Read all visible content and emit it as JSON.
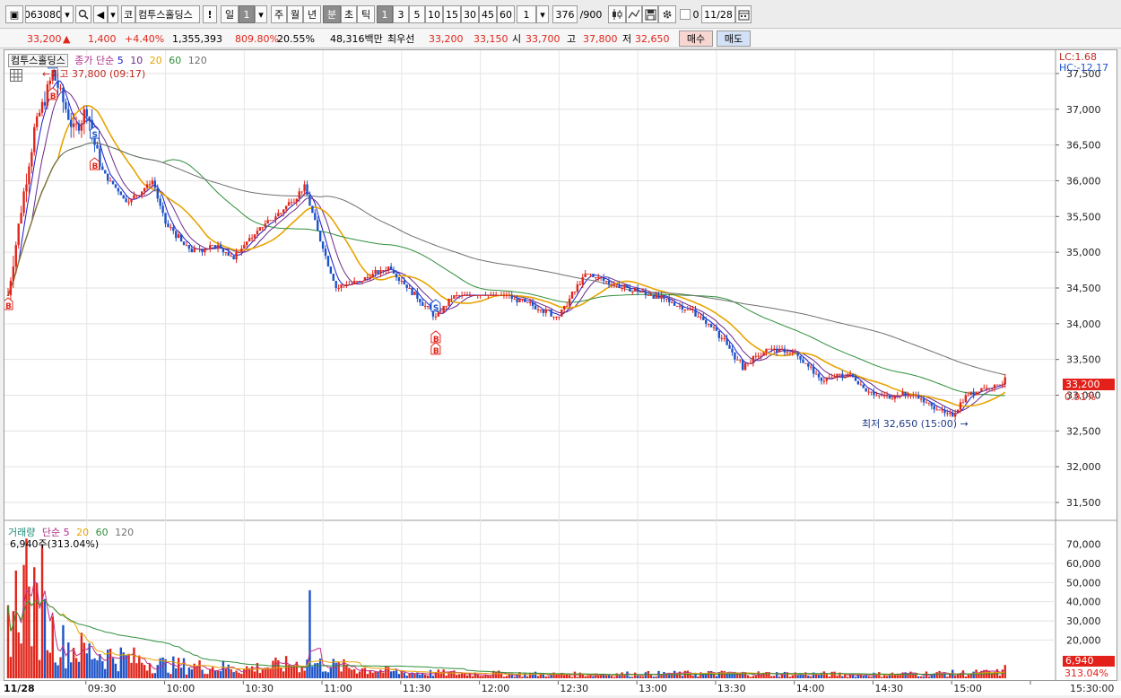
{
  "toolbar": {
    "code": "063080",
    "market_badge": "코",
    "stock_name": "컴투스홀딩스",
    "alert": "!",
    "periods": [
      "일",
      "1",
      "주",
      "월",
      "년",
      "분",
      "초",
      "틱"
    ],
    "minutes": [
      "1",
      "3",
      "5",
      "10",
      "15",
      "30",
      "45",
      "60"
    ],
    "interval": "1",
    "count": "376",
    "count_max": "/900",
    "checkbox_label": "0",
    "date": "11/28"
  },
  "quote": {
    "price": "33,200",
    "arrow": "▲",
    "change": "1,400",
    "change_pct": "+4.40%",
    "volume": "1,355,393",
    "volume_ratio": "809.80%",
    "turnover": "20.55%",
    "amount": "48,316백만",
    "priority": "최우선",
    "ask": "33,200",
    "bid": "33,150",
    "open_label": "시",
    "open": "33,700",
    "high_label": "고",
    "high": "37,800",
    "low_label": "저",
    "low": "32,650",
    "buy_label": "매수",
    "sell_label": "매도"
  },
  "price_panel": {
    "legend_name": "컴투스홀딩스",
    "legend_ma": "종가 단순",
    "ma_periods": [
      "5",
      "10",
      "20",
      "60",
      "120"
    ],
    "lc": "LC:1.68",
    "hc": "HC:-12.17",
    "high_note": "최고 37,800 (09:17)",
    "low_note": "최저 32,650 (15:00)",
    "last_price": "33,200",
    "last_pct": "0.91%",
    "y_ticks": [
      "37,500",
      "37,000",
      "36,500",
      "36,000",
      "35,500",
      "35,000",
      "34,500",
      "34,000",
      "33,500",
      "33,000",
      "32,500",
      "32,000",
      "31,500"
    ]
  },
  "volume_panel": {
    "legend_name": "거래량",
    "legend_ma": "단순",
    "ma_periods": [
      "5",
      "20",
      "60",
      "120"
    ],
    "current": "6,940주(313.04%)",
    "last_vol": "6,940",
    "last_pct": "313.04%",
    "y_ticks": [
      "70,000",
      "60,000",
      "50,000",
      "40,000",
      "30,000",
      "20,000"
    ]
  },
  "time_axis": {
    "date": "11/28",
    "labels": [
      "09:30",
      "10:00",
      "10:30",
      "11:00",
      "11:30",
      "12:00",
      "12:30",
      "13:00",
      "13:30",
      "14:00",
      "14:30",
      "15:00",
      "15:30:00"
    ]
  },
  "colors": {
    "up": "#e0261b",
    "down": "#1d53c8",
    "ma5": "#1a1ad0",
    "ma10": "#6a2a8a",
    "ma20": "#e8a400",
    "ma60": "#2f8f3a",
    "ma120": "#707070"
  },
  "chart_data": {
    "type": "candlestick",
    "x_unit": "time (1-minute bars)",
    "y_range": [
      31300,
      37800
    ],
    "anchors": [
      {
        "t": "09:00",
        "price": 34400
      },
      {
        "t": "09:05",
        "price": 35600
      },
      {
        "t": "09:10",
        "price": 36700
      },
      {
        "t": "09:17",
        "price": 37500
      },
      {
        "t": "09:25",
        "price": 36700
      },
      {
        "t": "09:30",
        "price": 37000
      },
      {
        "t": "09:35",
        "price": 36200
      },
      {
        "t": "09:45",
        "price": 35700
      },
      {
        "t": "09:55",
        "price": 36000
      },
      {
        "t": "10:00",
        "price": 35400
      },
      {
        "t": "10:10",
        "price": 35000
      },
      {
        "t": "10:20",
        "price": 35100
      },
      {
        "t": "10:25",
        "price": 34900
      },
      {
        "t": "10:35",
        "price": 35300
      },
      {
        "t": "10:45",
        "price": 35600
      },
      {
        "t": "10:53",
        "price": 35900
      },
      {
        "t": "10:58",
        "price": 35300
      },
      {
        "t": "11:05",
        "price": 34500
      },
      {
        "t": "11:15",
        "price": 34600
      },
      {
        "t": "11:25",
        "price": 34800
      },
      {
        "t": "11:35",
        "price": 34400
      },
      {
        "t": "11:43",
        "price": 34100
      },
      {
        "t": "11:50",
        "price": 34400
      },
      {
        "t": "12:10",
        "price": 34400
      },
      {
        "t": "12:30",
        "price": 34100
      },
      {
        "t": "12:40",
        "price": 34700
      },
      {
        "t": "12:55",
        "price": 34500
      },
      {
        "t": "13:05",
        "price": 34400
      },
      {
        "t": "13:20",
        "price": 34200
      },
      {
        "t": "13:30",
        "price": 33900
      },
      {
        "t": "13:40",
        "price": 33400
      },
      {
        "t": "13:50",
        "price": 33650
      },
      {
        "t": "14:00",
        "price": 33600
      },
      {
        "t": "14:10",
        "price": 33200
      },
      {
        "t": "14:20",
        "price": 33300
      },
      {
        "t": "14:30",
        "price": 33000
      },
      {
        "t": "14:45",
        "price": 33000
      },
      {
        "t": "15:00",
        "price": 32700
      },
      {
        "t": "15:05",
        "price": 33000
      },
      {
        "t": "15:20",
        "price": 33200
      }
    ],
    "volume_y_range": [
      0,
      75000
    ],
    "volume_anchors": [
      {
        "t": "09:00",
        "volume": 30000
      },
      {
        "t": "09:05",
        "volume": 45000
      },
      {
        "t": "09:10",
        "volume": 35000
      },
      {
        "t": "09:20",
        "volume": 18000
      },
      {
        "t": "09:30",
        "volume": 14000
      },
      {
        "t": "10:00",
        "volume": 7000
      },
      {
        "t": "10:30",
        "volume": 5000
      },
      {
        "t": "10:55",
        "volume": 8000
      },
      {
        "t": "11:00",
        "volume": 7000
      },
      {
        "t": "11:30",
        "volume": 3000
      },
      {
        "t": "12:30",
        "volume": 2000
      },
      {
        "t": "13:30",
        "volume": 2500
      },
      {
        "t": "14:30",
        "volume": 2000
      },
      {
        "t": "15:20",
        "volume": 3000
      }
    ],
    "volume_spikes": [
      {
        "t": "09:07",
        "volume": 73000
      },
      {
        "t": "09:13",
        "volume": 70000
      },
      {
        "t": "10:55",
        "volume": 46000
      },
      {
        "t": "15:20",
        "volume": 6940
      }
    ],
    "signals": [
      {
        "t": "09:00",
        "type": "B"
      },
      {
        "t": "09:17",
        "type": "S"
      },
      {
        "t": "09:17",
        "type": "B"
      },
      {
        "t": "09:33",
        "type": "S"
      },
      {
        "t": "09:33",
        "type": "B"
      },
      {
        "t": "11:43",
        "type": "S"
      },
      {
        "t": "11:43",
        "type": "B"
      },
      {
        "t": "11:43",
        "type": "B"
      }
    ],
    "moving_averages": [
      "5",
      "10",
      "20",
      "60",
      "120"
    ]
  }
}
